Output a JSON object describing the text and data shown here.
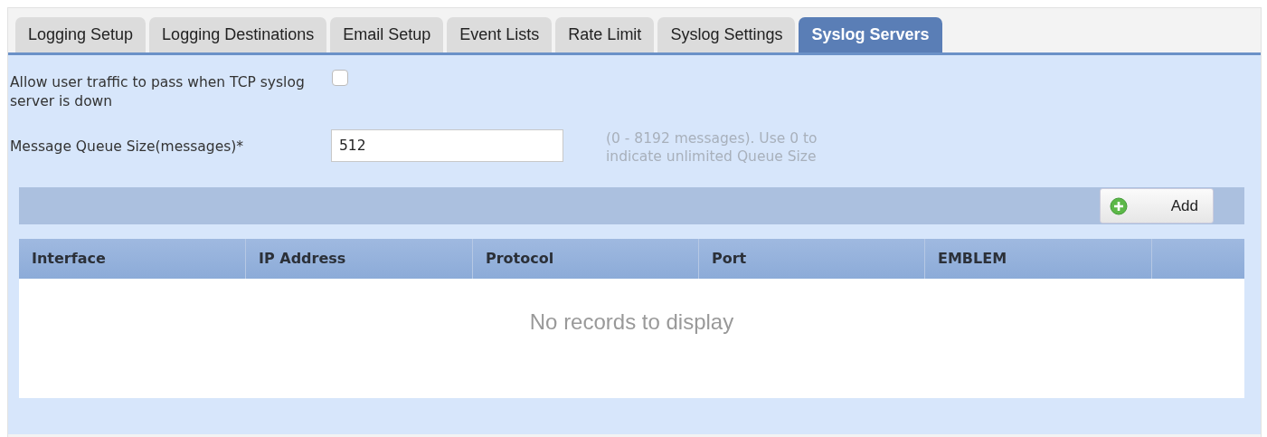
{
  "tabs": [
    {
      "label": "Logging Setup",
      "selected": false
    },
    {
      "label": "Logging Destinations",
      "selected": false
    },
    {
      "label": "Email Setup",
      "selected": false
    },
    {
      "label": "Event Lists",
      "selected": false
    },
    {
      "label": "Rate Limit",
      "selected": false
    },
    {
      "label": "Syslog Settings",
      "selected": false
    },
    {
      "label": "Syslog Servers",
      "selected": true
    }
  ],
  "allow_traffic": {
    "label": "Allow user traffic to pass when TCP syslog server is down",
    "checked": false
  },
  "queue_size": {
    "label": "Message Queue Size(messages)*",
    "value": "512",
    "hint": "(0 - 8192 messages). Use 0 to indicate unlimited Queue Size"
  },
  "toolbar": {
    "add_button": "Add"
  },
  "table": {
    "columns": [
      "Interface",
      "IP Address",
      "Protocol",
      "Port",
      "EMBLEM"
    ],
    "empty_message": "No records to display"
  }
}
